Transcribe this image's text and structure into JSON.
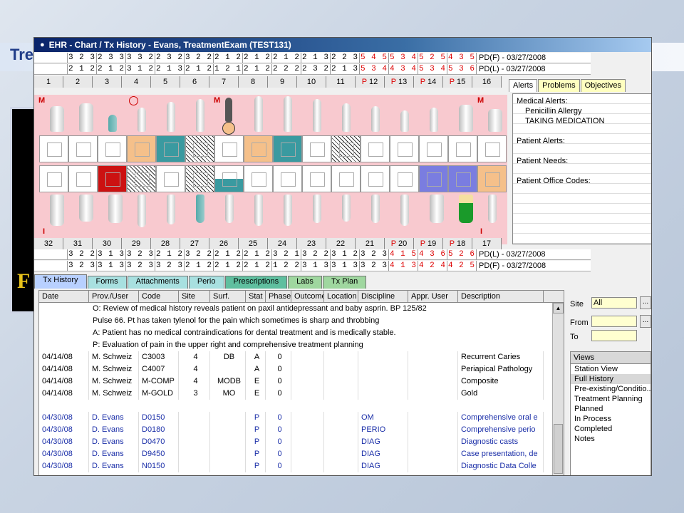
{
  "slide": {
    "title": "Tre",
    "panel_letter": "F"
  },
  "window": {
    "title": "EHR - Chart / Tx History - Evans, TreatmentExam (TEST131)"
  },
  "upper_pd_rows": [
    {
      "cells": [
        [
          "3 2 3",
          false
        ],
        [
          "2 3 3",
          false
        ],
        [
          "3 3 2",
          false
        ],
        [
          "2 3 2",
          false
        ],
        [
          "3 2 2",
          false
        ],
        [
          "2 1 2",
          false
        ],
        [
          "2 1 2",
          false
        ],
        [
          "2 1 2",
          false
        ],
        [
          "2 1 3",
          false
        ],
        [
          "2 2 3",
          false
        ],
        [
          "5 4 5",
          true
        ],
        [
          "5 3 4",
          true
        ],
        [
          "5 2 5",
          true
        ],
        [
          "4 3 5",
          true
        ]
      ],
      "label": "PD(F) - 03/27/2008"
    },
    {
      "cells": [
        [
          "2 1 2",
          false
        ],
        [
          "2 1 2",
          false
        ],
        [
          "3 1 2",
          false
        ],
        [
          "2 1 3",
          false
        ],
        [
          "2 1 2",
          false
        ],
        [
          "1 2 1",
          false
        ],
        [
          "2 1 2",
          false
        ],
        [
          "2 2 2",
          false
        ],
        [
          "2 3 2",
          false
        ],
        [
          "2 1 3",
          false
        ],
        [
          "5 3 4",
          true
        ],
        [
          "4 3 4",
          true
        ],
        [
          "5 3 4",
          true
        ],
        [
          "5 3 6",
          true
        ]
      ],
      "label": "PD(L) - 03/27/2008"
    }
  ],
  "upper_tooth_numbers": [
    [
      "",
      "1",
      false
    ],
    [
      "",
      "2",
      false
    ],
    [
      "",
      "3",
      false
    ],
    [
      "",
      "4",
      false
    ],
    [
      "",
      "5",
      false
    ],
    [
      "",
      "6",
      false
    ],
    [
      "",
      "7",
      false
    ],
    [
      "",
      "8",
      false
    ],
    [
      "",
      "9",
      false
    ],
    [
      "",
      "10",
      false
    ],
    [
      "",
      "11",
      false
    ],
    [
      "P",
      "12",
      false
    ],
    [
      "P",
      "13",
      false
    ],
    [
      "P",
      "14",
      false
    ],
    [
      "P",
      "15",
      false
    ],
    [
      "",
      "16",
      false
    ]
  ],
  "lower_tooth_numbers": [
    [
      "",
      "32",
      false
    ],
    [
      "",
      "31",
      false
    ],
    [
      "",
      "30",
      false
    ],
    [
      "",
      "29",
      false
    ],
    [
      "",
      "28",
      false
    ],
    [
      "",
      "27",
      false
    ],
    [
      "",
      "26",
      false
    ],
    [
      "",
      "25",
      false
    ],
    [
      "",
      "24",
      false
    ],
    [
      "",
      "23",
      false
    ],
    [
      "",
      "22",
      false
    ],
    [
      "",
      "21",
      false
    ],
    [
      "P",
      "20",
      false
    ],
    [
      "P",
      "19",
      false
    ],
    [
      "P",
      "18",
      false
    ],
    [
      "",
      "17",
      false
    ]
  ],
  "lower_pd_rows": [
    {
      "cells": [
        [
          "3 2 2",
          false
        ],
        [
          "3 1 3",
          false
        ],
        [
          "3 2 3",
          false
        ],
        [
          "2 1 2",
          false
        ],
        [
          "3 2 2",
          false
        ],
        [
          "2 1 2",
          false
        ],
        [
          "2 1 2",
          false
        ],
        [
          "3 2 1",
          false
        ],
        [
          "3 2 2",
          false
        ],
        [
          "3 1 2",
          false
        ],
        [
          "3 2 3",
          false
        ],
        [
          "4 1 5",
          true
        ],
        [
          "4 3 6",
          true
        ],
        [
          "5 2 6",
          true
        ]
      ],
      "label": "PD(L) - 03/27/2008"
    },
    {
      "cells": [
        [
          "3 2 3",
          false
        ],
        [
          "3 1 3",
          false
        ],
        [
          "3 2 3",
          false
        ],
        [
          "3 2 3",
          false
        ],
        [
          "2 1 2",
          false
        ],
        [
          "2 1 2",
          false
        ],
        [
          "2 1 2",
          false
        ],
        [
          "1 2 2",
          false
        ],
        [
          "3 1 3",
          false
        ],
        [
          "3 1 3",
          false
        ],
        [
          "3 2 3",
          false
        ],
        [
          "4 1 3",
          true
        ],
        [
          "4 2 4",
          true
        ],
        [
          "4 2 5",
          true
        ]
      ],
      "label": "PD(F) - 03/27/2008"
    }
  ],
  "chart_marks": {
    "m": "M",
    "i": "I"
  },
  "alerts": {
    "tabs": [
      "Alerts",
      "Problems",
      "Objectives"
    ],
    "medical_label": "Medical Alerts:",
    "medical_items": [
      "Penicillin Allergy",
      "TAKING MEDICATION"
    ],
    "patient_alerts": "Patient Alerts:",
    "patient_needs": "Patient Needs:",
    "office_codes": "Patient Office Codes:"
  },
  "bottom_tabs": [
    "Tx History",
    "Forms",
    "Attachments",
    "Perio",
    "Prescriptions",
    "Labs",
    "Tx Plan"
  ],
  "history": {
    "columns": [
      "Date",
      "Prov./User",
      "Code",
      "Site",
      "Surf.",
      "Stat",
      "Phase",
      "Outcome",
      "Location",
      "Discipline",
      "Appr. User",
      "Description"
    ],
    "notes": [
      "O: Review of medical history reveals patient on paxil antidepressant and baby asprin. BP 125/82",
      "Pulse 66. Pt has taken tylenol for the pain which sometimes is sharp and throbbing",
      "A: Patient has no medical contraindications for dental treatment and is medically stable.",
      "P: Evaluation of pain in the upper right and comprehensive treatment planning"
    ],
    "rows": [
      [
        "04/14/08",
        "M. Schweiz",
        "C3003",
        "4",
        "DB",
        "A",
        "0",
        "",
        "",
        "",
        "",
        "Recurrent Caries"
      ],
      [
        "04/14/08",
        "M. Schweiz",
        "C4007",
        "4",
        "",
        "A",
        "0",
        "",
        "",
        "",
        "",
        "Periapical Pathology"
      ],
      [
        "04/14/08",
        "M. Schweiz",
        "M-COMP",
        "4",
        "MODB",
        "E",
        "0",
        "",
        "",
        "",
        "",
        "Composite"
      ],
      [
        "04/14/08",
        "M. Schweiz",
        "M-GOLD",
        "3",
        "MO",
        "E",
        "0",
        "",
        "",
        "",
        "",
        "Gold"
      ]
    ],
    "blue_rows": [
      [
        "04/30/08",
        "D. Evans",
        "D0150",
        "",
        "",
        "P",
        "0",
        "",
        "",
        "OM",
        "",
        "Comprehensive oral e"
      ],
      [
        "04/30/08",
        "D. Evans",
        "D0180",
        "",
        "",
        "P",
        "0",
        "",
        "",
        "PERIO",
        "",
        "Comprehensive perio"
      ],
      [
        "04/30/08",
        "D. Evans",
        "D0470",
        "",
        "",
        "P",
        "0",
        "",
        "",
        "DIAG",
        "",
        "Diagnostic casts"
      ],
      [
        "04/30/08",
        "D. Evans",
        "D9450",
        "",
        "",
        "P",
        "0",
        "",
        "",
        "DIAG",
        "",
        "Case presentation, de"
      ],
      [
        "04/30/08",
        "D. Evans",
        "N0150",
        "",
        "",
        "P",
        "0",
        "",
        "",
        "DIAG",
        "",
        "Diagnostic Data Colle"
      ]
    ]
  },
  "filters": {
    "site_label": "Site",
    "site_value": "All",
    "from_label": "From",
    "to_label": "To",
    "btn": "..."
  },
  "views": {
    "header": "Views",
    "items": [
      "Station View",
      "Full History",
      "Pre-existing/Conditio...",
      "Treatment Planning",
      "Planned",
      "In Process",
      "Completed",
      "Notes"
    ],
    "selected": 1
  }
}
